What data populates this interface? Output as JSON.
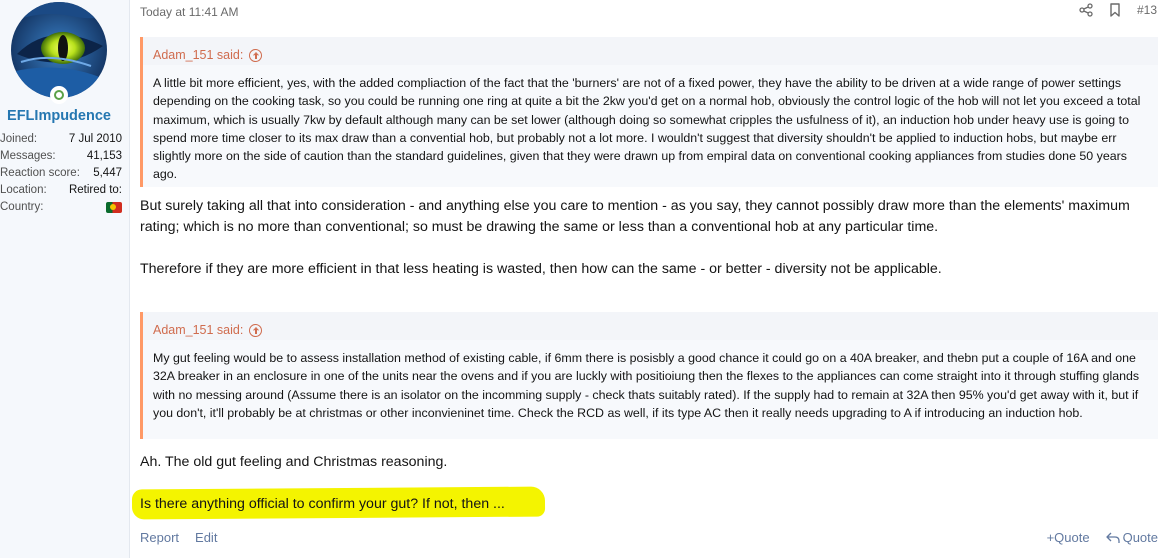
{
  "user": {
    "name": "EFLImpudence",
    "stats": [
      {
        "key": "Joined:",
        "value": "7 Jul 2010"
      },
      {
        "key": "Messages:",
        "value": "41,153"
      },
      {
        "key": "Reaction score:",
        "value": "5,447"
      },
      {
        "key": "Location:",
        "value": "Retired to:"
      },
      {
        "key": "Country:",
        "value": ""
      }
    ],
    "avatar_icon": "avatar-eye-icon",
    "online_icon": "online-status-icon",
    "flag_icon": "portugal-flag-icon"
  },
  "post": {
    "date": "Today at 11:41 AM",
    "number": "#13",
    "share_icon": "share-icon",
    "bookmark_icon": "bookmark-icon"
  },
  "quotes": [
    {
      "author": "Adam_151 said:",
      "text": "A little bit more efficient, yes, with the added compliaction of the fact that the 'burners' are not of a fixed power, they have the ability to be driven at a wide range of power settings depending on the cooking task, so you could be running one ring at quite a bit the 2kw you'd get on a normal hob, obviously the control logic of the hob will not let you exceed a total maximum, which is usually 7kw by default although many can be set lower (although doing so somewhat cripples the usfulness of it), an induction hob under heavy use is going to spend more time closer to its max draw than a convential hob, but probably not a lot more. I wouldn't suggest that diversity shouldn't be applied to induction hobs, but maybe err slightly more on the side of caution than the standard guidelines, given that they were drawn up from empiral data on conventional cooking appliances from studies done 50 years ago."
    },
    {
      "author": "Adam_151 said:",
      "text": "My gut feeling would be to assess installation method of existing cable, if 6mm there is posisbly a good chance it could go on a 40A breaker, and thebn put a couple of 16A and one 32A breaker in an enclosure in one of the units near the ovens and if you are luckly with positioiung then the flexes to the appliances can come straight into it through stuffing glands with no messing around (Assume there is an isolator on the incomming supply - check thats suitably rated). If the supply had to remain at 32A then 95% you'd get away with it, but if you don't, it'll probably be at christmas or other inconvieninet time. Check the RCD as well, if its type AC then it really needs upgrading to A if introducing an induction hob."
    }
  ],
  "paragraphs": [
    "But surely taking all that into consideration - and anything else you care to mention - as you say, they cannot possibly draw more than the elements' maximum rating; which is no more than conventional; so must be drawing the same or less than a conventional hob at any particular time.",
    "Therefore if they are more efficient in that less heating is wasted, then how can the same - or better - diversity not be applicable.",
    "Ah. The old gut feeling and Christmas reasoning.",
    "Is there anything official to confirm your gut? If not, then ..."
  ],
  "footer": {
    "report": "Report",
    "edit": "Edit",
    "multiquote": "+Quote",
    "quote": "Quote",
    "quote_icon": "reply-icon"
  },
  "colors": {
    "quote_border": "#ff9966",
    "username": "#2577b1",
    "highlight": "#f4f400"
  }
}
